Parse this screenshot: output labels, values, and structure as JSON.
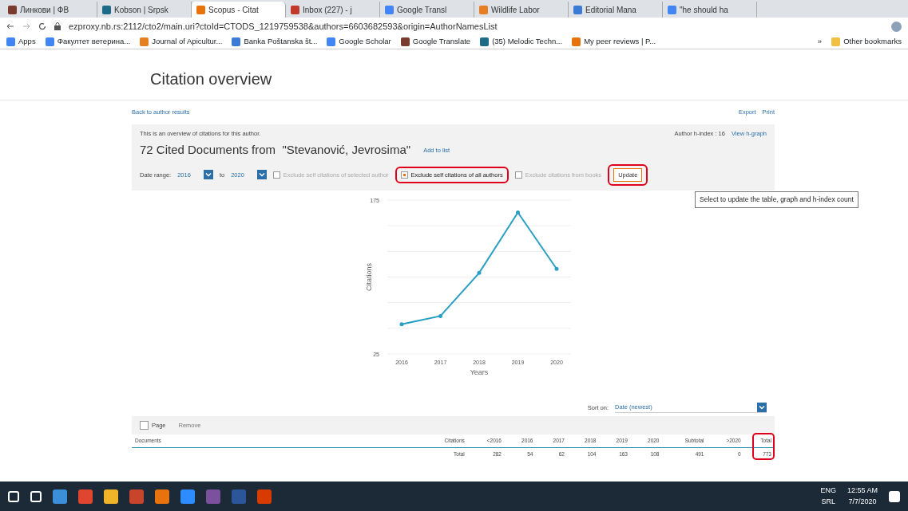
{
  "browser": {
    "tabs": [
      {
        "label": "Линкови | ФВ",
        "selected": false
      },
      {
        "label": "Kobson | Srpsk",
        "selected": false
      },
      {
        "label": "Scopus - Citat",
        "selected": true
      },
      {
        "label": "Inbox (227) - j",
        "selected": false
      },
      {
        "label": "Google Transl",
        "selected": false
      },
      {
        "label": "Wildlife Labor",
        "selected": false
      },
      {
        "label": "Editorial Mana",
        "selected": false
      },
      {
        "label": "\"he should ha",
        "selected": false
      }
    ],
    "address": "ezproxy.nb.rs:2112/cto2/main.uri?ctoId=CTODS_1219759538&authors=6603682593&origin=AuthorNamesList",
    "bookmarks": [
      "Apps",
      "Факултет ветерина...",
      "Journal of Apicultur...",
      "Banka Poštanska št...",
      "Google Scholar",
      "Google Translate",
      "(35) Melodic Techn...",
      "My peer reviews | P..."
    ],
    "more_bookmarks": "»",
    "other_bookmarks": "Other bookmarks"
  },
  "page": {
    "title": "Citation overview",
    "back_link": "Back to author results",
    "export": "Export",
    "print": "Print",
    "intro": "This is an overview of citations for this author.",
    "h_index": "Author h-index : 16",
    "h_graph": "View h-graph",
    "heading": "72 Cited Documents from  \"Stevanović, Jevrosima\"",
    "add_to_list": "Add to list",
    "date_range_label": "Date range:",
    "date_from": "2016",
    "date_to_label": "to",
    "date_to": "2020",
    "filters": [
      {
        "label": "Exclude self citations of selected author",
        "checked": false
      },
      {
        "label": "Exclude self citations of all authors",
        "checked": true
      },
      {
        "label": "Exclude citations from books",
        "checked": false
      }
    ],
    "update": "Update",
    "tooltip": "Select to update the table, graph and h-index count",
    "chart_data": {
      "type": "line",
      "xlabel": "Years",
      "ylabel": "Citations",
      "categories": [
        "2016",
        "2017",
        "2018",
        "2019",
        "2020"
      ],
      "series": [
        {
          "color": "#2a9fc4",
          "values": [
            54,
            62,
            104,
            163,
            108
          ]
        }
      ],
      "ylim": [
        25,
        175
      ],
      "yticks": [
        25,
        175
      ]
    },
    "sort_label": "Sort on:",
    "sort_value": "Date (newest)",
    "page_select": {
      "label": "Page",
      "checked": false
    },
    "remove": "Remove",
    "columns": [
      "Documents",
      "Citations",
      "<2016",
      "2016",
      "2017",
      "2018",
      "2019",
      "2020",
      "Subtotal",
      ">2020",
      "Total"
    ],
    "total_row": [
      "Total",
      "282",
      "54",
      "62",
      "104",
      "163",
      "108",
      "491",
      "0",
      "773"
    ]
  },
  "taskbar": {
    "lang": "ENG",
    "layout": "SRL",
    "time": "12:55 AM",
    "date": "7/7/2020"
  }
}
